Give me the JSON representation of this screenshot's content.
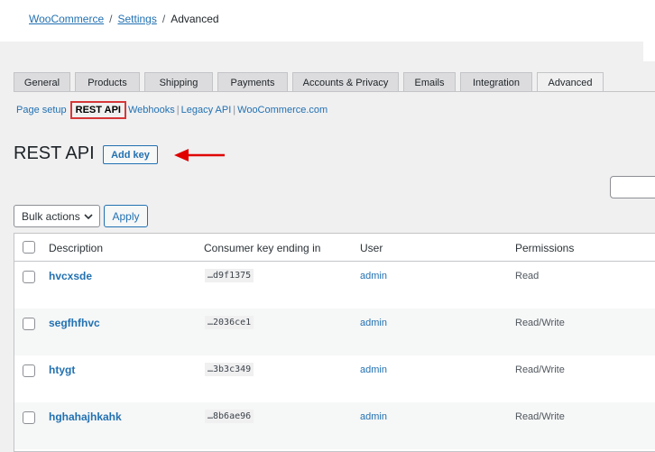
{
  "breadcrumb": {
    "items": [
      "WooCommerce",
      "Settings"
    ],
    "current": "Advanced",
    "separator": "/"
  },
  "tabs": [
    {
      "label": "General",
      "width": 63,
      "active": false
    },
    {
      "label": "Products",
      "width": 72,
      "active": false
    },
    {
      "label": "Shipping",
      "width": 76,
      "active": false
    },
    {
      "label": "Payments",
      "width": 78,
      "active": false
    },
    {
      "label": "Accounts & Privacy",
      "width": 118,
      "active": false
    },
    {
      "label": "Emails",
      "width": 58,
      "active": false
    },
    {
      "label": "Integration",
      "width": 80,
      "active": false
    },
    {
      "label": "Advanced",
      "width": 74,
      "active": true
    }
  ],
  "subnav": {
    "items": [
      "Page setup",
      "REST API",
      "Webhooks",
      "Legacy API",
      "WooCommerce.com"
    ],
    "current": "REST API"
  },
  "heading": "REST API",
  "add_key_label": "Add key",
  "bulk_actions": {
    "selected": "Bulk actions",
    "apply_label": "Apply"
  },
  "table": {
    "columns": [
      "Description",
      "Consumer key ending in",
      "User",
      "Permissions"
    ],
    "rows": [
      {
        "description": "hvcxsde",
        "key": "…d9f1375",
        "user": "admin",
        "permissions": "Read"
      },
      {
        "description": "segfhfhvc",
        "key": "…2036ce1",
        "user": "admin",
        "permissions": "Read/Write"
      },
      {
        "description": "htygt",
        "key": "…3b3c349",
        "user": "admin",
        "permissions": "Read/Write"
      },
      {
        "description": "hghahajhkahk",
        "key": "…8b6ae96",
        "user": "admin",
        "permissions": "Read/Write"
      }
    ]
  },
  "colors": {
    "link": "#2271b1",
    "highlight": "#d63638",
    "background": "#f0f0f1"
  }
}
